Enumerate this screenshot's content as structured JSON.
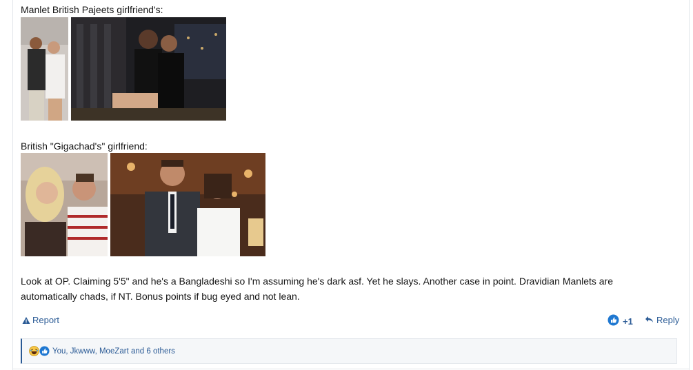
{
  "post": {
    "caption_1": "Manlet British Pajeets girlfriend's:",
    "caption_2": "British \"Gigachad's\" girlfriend:",
    "body": "Look at OP. Claiming 5'5\" and he's a Bangladeshi so I'm assuming he's dark asf. Yet he slays. Another case in point. Dravidian Manlets are automatically chads, if NT. Bonus points if bug eyed and not lean."
  },
  "actions": {
    "report_label": "Report",
    "vote_score": "+1",
    "reply_label": "Reply"
  },
  "reactions": {
    "summary": "You, Jkwww, MoeZart and 6 others",
    "icons": [
      "laughing-emoji-icon",
      "like-icon"
    ]
  },
  "colors": {
    "link": "#2a5a95",
    "text": "#141414",
    "reaction_bar_bg": "#f5f7f9"
  }
}
